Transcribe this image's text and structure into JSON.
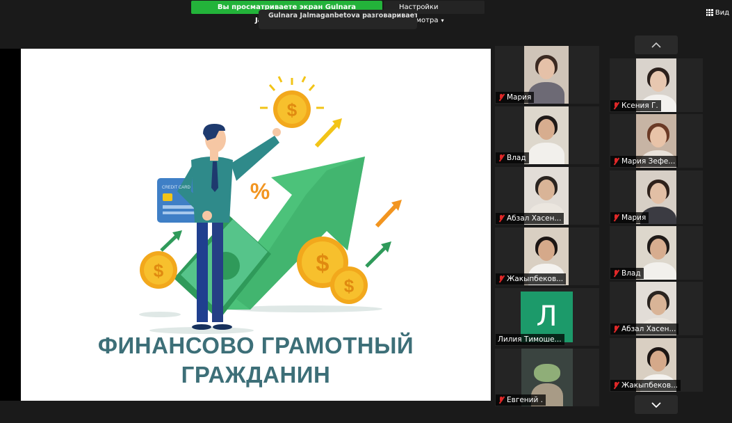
{
  "topbar": {
    "share_banner": "Вы просматриваете экран Gulnara Jalmaganbetova",
    "view_settings": "Настройки просмотра",
    "speaker": "Gulnara Jalmaganbetova разговаривает...",
    "view_button": "Вид"
  },
  "slide": {
    "title_line1": "ФИНАНСОВО  ГРАМОТНЫЙ",
    "title_line2": "ГРАЖДАНИН",
    "percent": "%",
    "coin_symbol": "$",
    "card_label": "CREDIT CARD"
  },
  "participants_col1": [
    {
      "name": "Мария"
    },
    {
      "name": "Влад"
    },
    {
      "name": "Абзал Хасен..."
    },
    {
      "name": "Жакыпбеков..."
    },
    {
      "name": "Лилия Тимоше...",
      "avatar_letter": "Л"
    },
    {
      "name": "Евгений ."
    }
  ],
  "participants_col2": [
    {
      "name": "Ксения Г."
    },
    {
      "name": "Мария Зефе..."
    },
    {
      "name": "Мария"
    },
    {
      "name": "Влад"
    },
    {
      "name": "Абзал Хасен..."
    },
    {
      "name": "Жакыпбеков..."
    }
  ],
  "colors": {
    "share_green": "#23b33a",
    "slide_title": "#3d6f78",
    "avatar_green": "#1c9a6a",
    "muted_red": "#e02828"
  }
}
